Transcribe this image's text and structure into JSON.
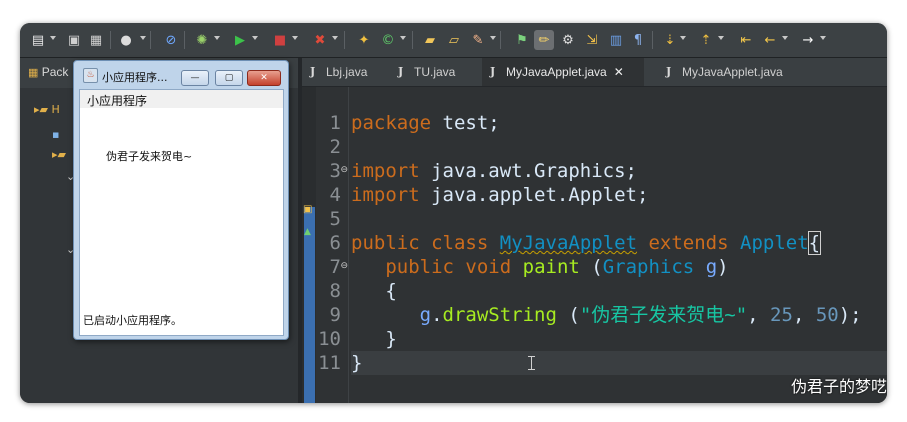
{
  "leftpane": {
    "tab_label": "Pack"
  },
  "editor_tabs": [
    {
      "label": "Lbj.java",
      "active": false,
      "icon": "java-file-icon"
    },
    {
      "label": "TU.java",
      "active": false,
      "icon": "java-file-icon"
    },
    {
      "label": "MyJavaApplet.java",
      "active": true,
      "icon": "java-file-icon",
      "close": "✕"
    },
    {
      "label": "MyJavaApplet.java",
      "active": false,
      "icon": "java-file-icon"
    }
  ],
  "line_numbers": [
    "1",
    "2",
    "3",
    "4",
    "5",
    "6",
    "7",
    "8",
    "9",
    "10",
    "11"
  ],
  "code": {
    "l1_kw": "package",
    "l1_rest": " test;",
    "l3_kw": "import",
    "l3_rest": " java.awt.Graphics;",
    "l4_kw": "import",
    "l4_rest": " java.applet.Applet;",
    "l6_kw1": "public",
    "l6_kw2": "class",
    "l6_name": "MyJavaApplet",
    "l6_kw3": "extends",
    "l6_sup": "Applet",
    "l6_brace": "{",
    "l7_kw1": "public",
    "l7_kw2": "void",
    "l7_meth": "paint",
    "l7_open": " (",
    "l7_type": "Graphics",
    "l7_param": " g",
    "l7_close": ")",
    "l8": "{",
    "l9_var": "g",
    "l9_dot": ".",
    "l9_meth": "drawString",
    "l9_open": " (",
    "l9_str": "\"伪君子发来贺电~\"",
    "l9_c1": ", ",
    "l9_n1": "25",
    "l9_c2": ", ",
    "l9_n2": "50",
    "l9_end": ");",
    "l10": "}",
    "l11": "}"
  },
  "applet": {
    "title": "小应用程序...",
    "menu": "小应用程序",
    "canvas_text": "伪君子发来贺电~",
    "status": "已启动小应用程序。",
    "btn_min": "—",
    "btn_max": "▢",
    "btn_close": "✕"
  },
  "watermark": "伪君子的梦呓",
  "colors": {
    "keyword": "#cc6c1d",
    "class": "#1290c3",
    "method": "#a7ec21",
    "string": "#17c6a3",
    "number": "#6897bb",
    "background": "#2f3234"
  }
}
